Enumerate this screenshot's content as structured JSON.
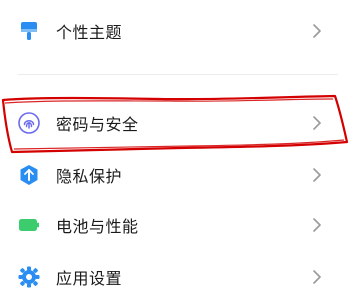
{
  "settings": {
    "items": [
      {
        "label": "个性主题",
        "icon": "theme-icon"
      },
      {
        "label": "密码与安全",
        "icon": "fingerprint-icon"
      },
      {
        "label": "隐私保护",
        "icon": "privacy-shield-icon"
      },
      {
        "label": "电池与性能",
        "icon": "battery-icon"
      },
      {
        "label": "应用设置",
        "icon": "gear-icon"
      }
    ]
  },
  "colors": {
    "accent_blue": "#2a8df2",
    "battery_green": "#3ccc6e",
    "annotation_red": "#d40000",
    "text": "#1a1a1a",
    "chevron": "#9a9a9a"
  }
}
